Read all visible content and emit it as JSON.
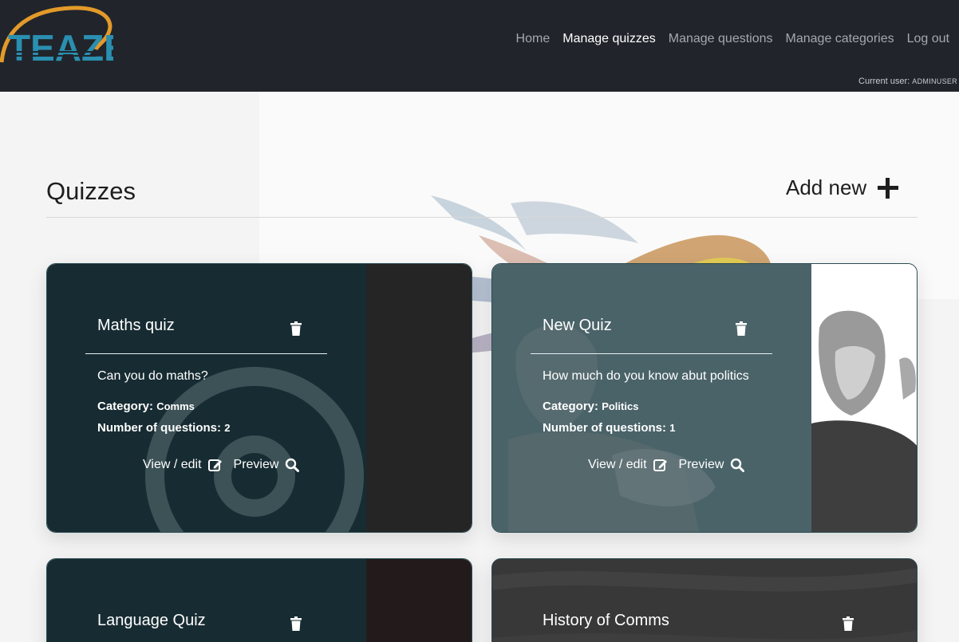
{
  "header": {
    "logo_text": "TEAZE",
    "nav": [
      {
        "label": "Home",
        "active": false
      },
      {
        "label": "Manage quizzes",
        "active": true
      },
      {
        "label": "Manage questions",
        "active": false
      },
      {
        "label": "Manage categories",
        "active": false
      },
      {
        "label": "Log out",
        "active": false
      }
    ],
    "current_user_label": "Current user:",
    "current_user_name": "ADMINUSER"
  },
  "page": {
    "title": "Quizzes",
    "add_new_label": "Add new",
    "add_new_icon": "plus-icon"
  },
  "quizzes": [
    {
      "title": "Maths quiz",
      "description": "Can you do maths?",
      "category_label": "Category:",
      "category": "Comms",
      "questions_label": "Number of questions:",
      "questions": "2",
      "view_edit_label": "View / edit",
      "preview_label": "Preview"
    },
    {
      "title": "New Quiz",
      "description": "How much do you know abut politics",
      "category_label": "Category:",
      "category": "Politics",
      "questions_label": "Number of questions:",
      "questions": "1",
      "view_edit_label": "View / edit",
      "preview_label": "Preview"
    },
    {
      "title": "Language Quiz"
    },
    {
      "title": "History of Comms"
    }
  ],
  "colors": {
    "navbar": "#21252b",
    "card_dark": "#172c32",
    "card_slate": "#4a6369",
    "accent_logo": "#e39a2a",
    "logo_blue": "#2a8fb0"
  }
}
